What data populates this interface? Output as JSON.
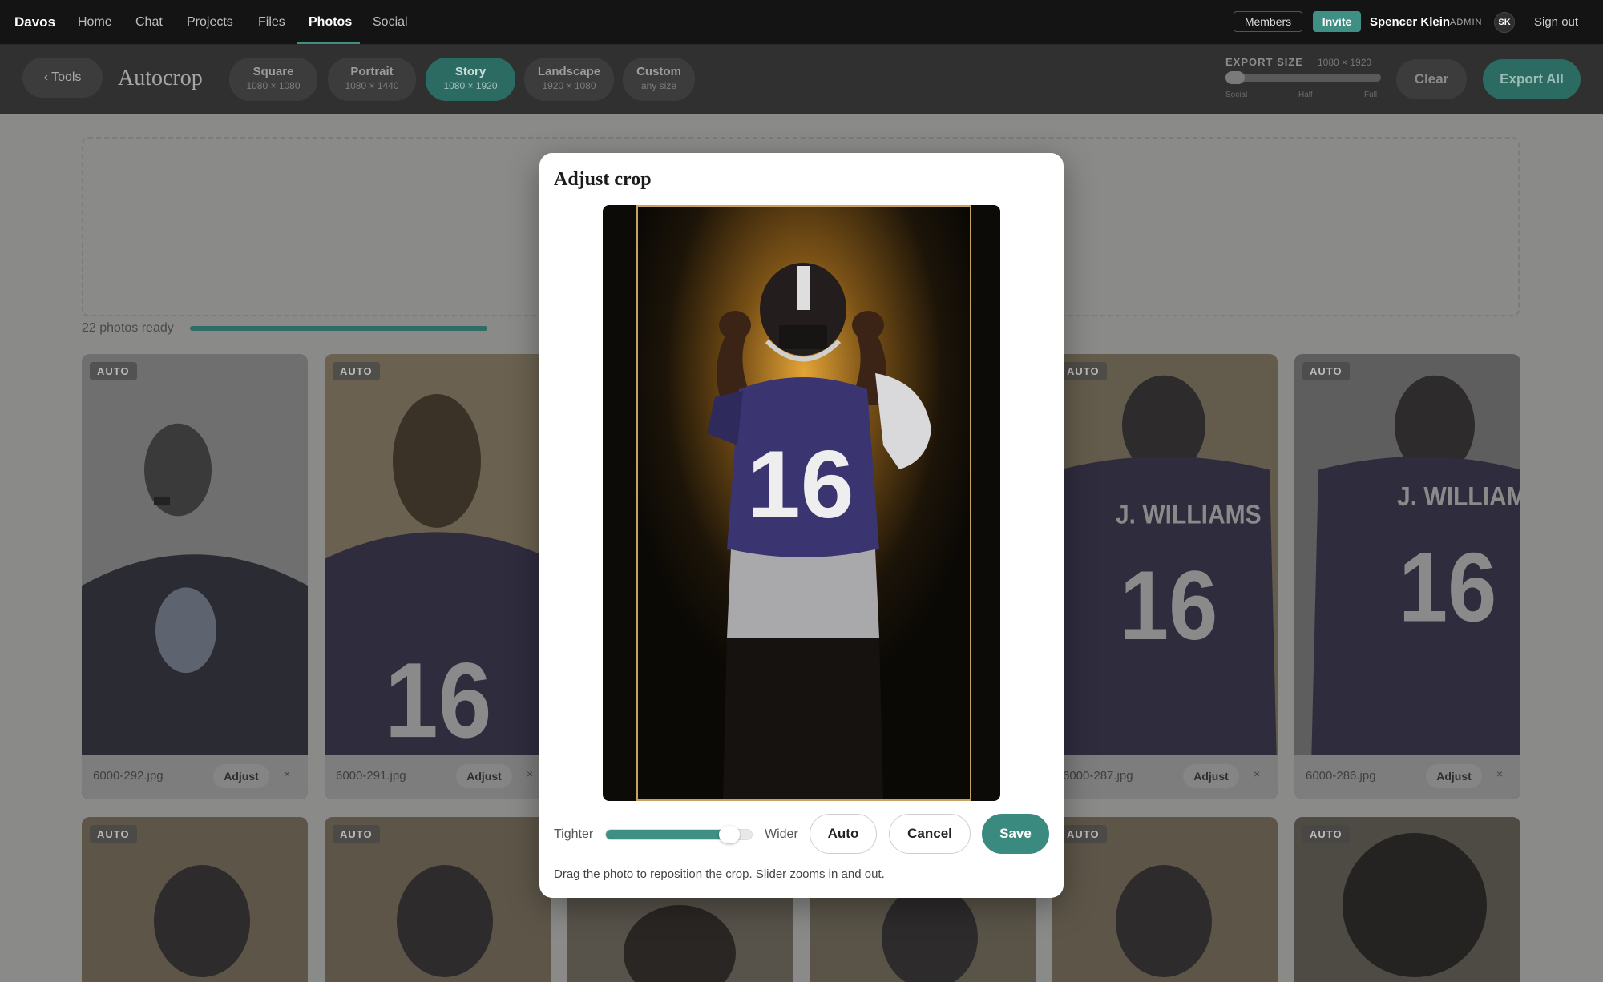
{
  "nav": {
    "brand": "Davos",
    "links": [
      "Home",
      "Chat",
      "Projects",
      "Files",
      "Photos",
      "Social"
    ],
    "active": "Photos",
    "members_label": "Members",
    "invite_label": "Invite",
    "user_name": "Spencer Klein",
    "user_role": "ADMIN",
    "avatar_initials": "SK",
    "signout_label": "Sign out"
  },
  "toolbar": {
    "back_label": "‹ Tools",
    "title": "Autocrop",
    "ratios": [
      {
        "name": "Square",
        "size": "1080 × 1080"
      },
      {
        "name": "Portrait",
        "size": "1080 × 1440"
      },
      {
        "name": "Story",
        "size": "1080 × 1920"
      },
      {
        "name": "Landscape",
        "size": "1920 × 1080"
      },
      {
        "name": "Custom",
        "size": "any size"
      }
    ],
    "active_ratio": "Story",
    "export_size_label": "EXPORT SIZE",
    "export_size_value": "1080 × 1920",
    "export_level": 0,
    "export_ticks": [
      "Social",
      "Half",
      "Full"
    ],
    "clear_label": "Clear",
    "export_all_label": "Export All"
  },
  "status": {
    "ready_label": "22 photos ready",
    "progress": 1.0
  },
  "grid": {
    "auto_badge": "AUTO",
    "adjust_label": "Adjust",
    "remove_glyph": "×",
    "row1": [
      {
        "file": "6000-292.jpg"
      },
      {
        "file": "6000-291.jpg"
      },
      {
        "file": "6000-287.jpg"
      },
      {
        "file": "6000-286.jpg"
      }
    ]
  },
  "modal": {
    "title": "Adjust crop",
    "tighter_label": "Tighter",
    "wider_label": "Wider",
    "zoom_level": 0.85,
    "auto_label": "Auto",
    "cancel_label": "Cancel",
    "save_label": "Save",
    "hint": "Drag the photo to reposition the crop. Slider zooms in and out."
  },
  "colors": {
    "accent": "#3f8f84",
    "crop_border": "#c8a25e",
    "jersey": "#3a3470"
  }
}
